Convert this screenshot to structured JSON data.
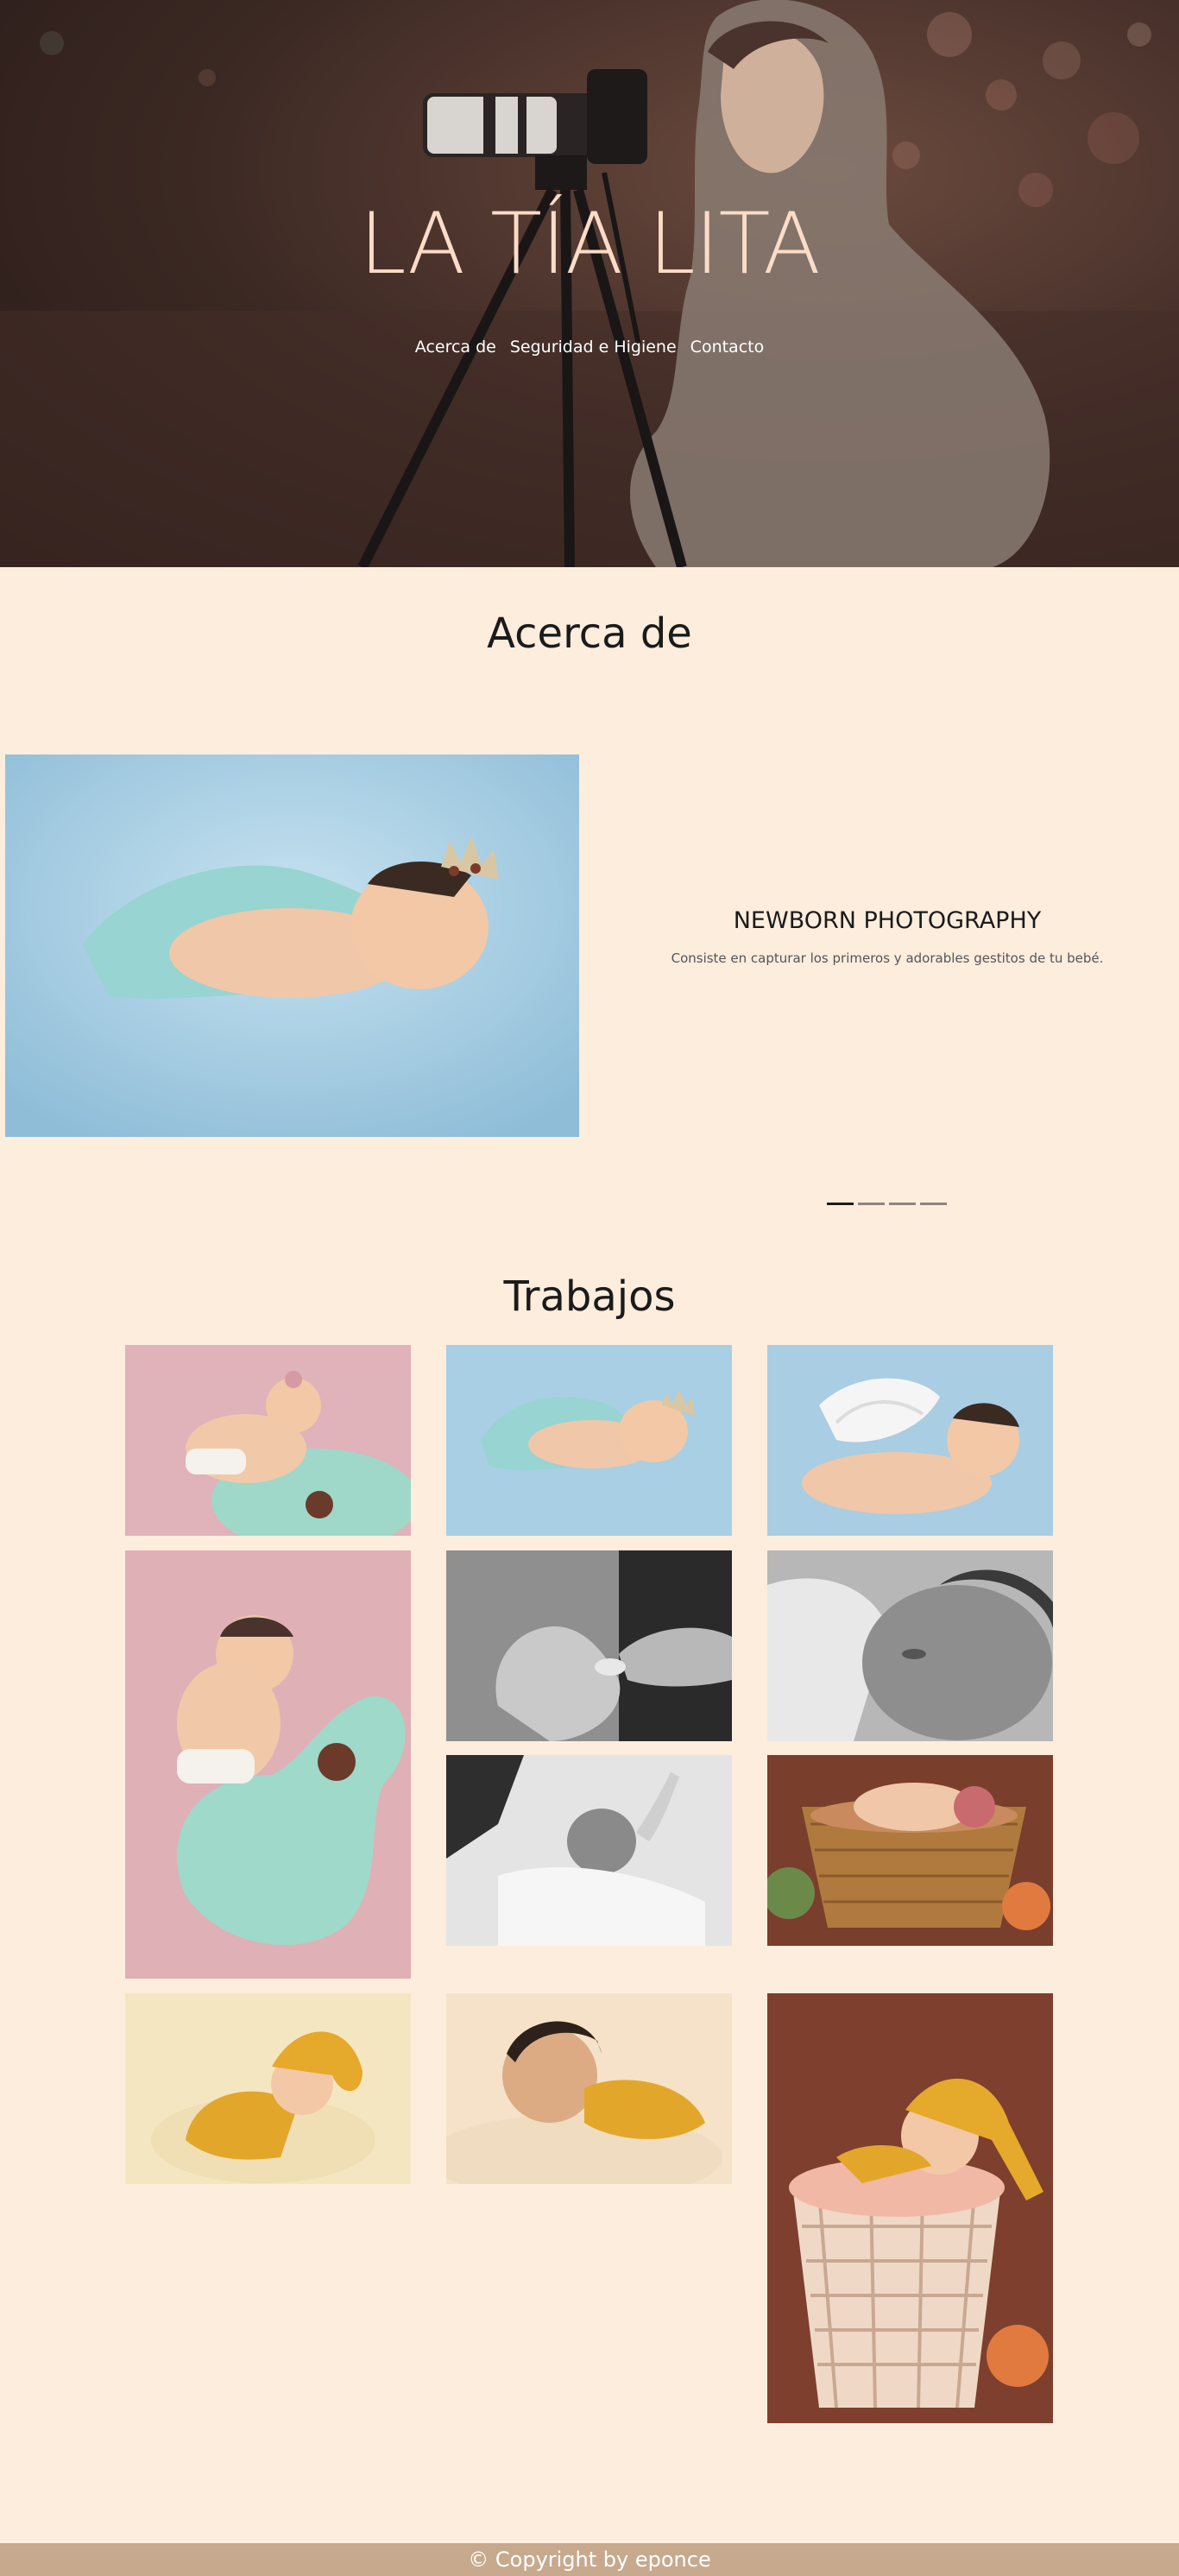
{
  "hero": {
    "title": "LA TÍA LITA",
    "nav": [
      "Acerca de",
      "Seguridad e Higiene",
      "Contacto"
    ]
  },
  "about": {
    "title": "Acerca de",
    "slide": {
      "title": "NEWBORN PHOTOGRAPHY",
      "text": "Consiste en capturar los primeros y adorables gestitos de tu bebé.",
      "image_icon": "baby-crown-photo"
    },
    "indicator_count": 4,
    "active_indicator": 1
  },
  "works": {
    "title": "Trabajos",
    "photos": [
      "baby-pink-seahorse-photo",
      "baby-crown-blue-photo",
      "baby-angel-wings-photo",
      "baby-seahorse-tall-photo",
      "hands-bw-photo",
      "baby-face-bw-photo",
      "baby-stretch-bw-photo",
      "baby-basket-flowers-photo",
      "baby-yellow-hat-photo",
      "baby-yellow-sweater-photo",
      "baby-basket-tall-photo"
    ]
  },
  "footer": {
    "copyright": "© Copyright by eponce"
  },
  "colors": {
    "page_background": "#fdeddd",
    "hero_title": "#fcdcc8",
    "footer_background": "#c7a98d",
    "footer_text": "#ffffff",
    "indicator_active": "#1b1b1b",
    "indicator_inactive": "#8e8580"
  }
}
